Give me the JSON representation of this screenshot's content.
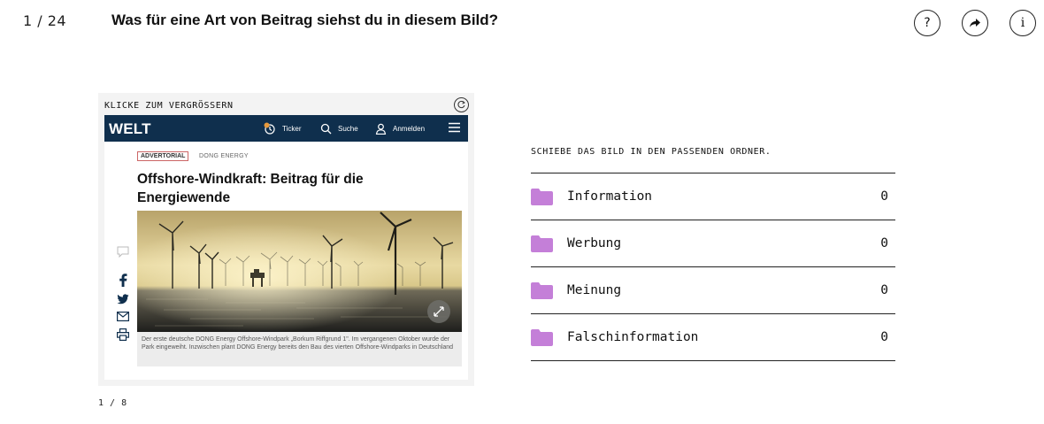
{
  "header": {
    "counter": "1 / 24",
    "question": "Was für eine Art von Beitrag siehst du in diesem Bild?",
    "buttons": {
      "help": "?",
      "share": "share-icon",
      "info": "i"
    }
  },
  "card": {
    "label": "KLICKE ZUM VERGRÖSSERN",
    "pager": "1 / 8",
    "article": {
      "brand": "WELT",
      "nav": {
        "ticker": "Ticker",
        "search": "Suche",
        "login": "Anmelden"
      },
      "tag": "ADVERTORIAL",
      "sponsor": "DONG ENERGY",
      "headline": "Offshore-Windkraft: Beitrag für die Energiewende",
      "caption": "Der erste deutsche DONG Energy Offshore-Windpark „Borkum Riffgrund 1\". Im vergangenen Oktober wurde der Park eingeweiht. Inzwischen plant DONG Energy bereits den Bau des vierten Offshore-Windparks in Deutschland",
      "colors": {
        "navbar": "#0f2f4d",
        "tag_border": "#cc6666"
      }
    }
  },
  "sort": {
    "instruction": "SCHIEBE DAS BILD IN DEN PASSENDEN ORDNER.",
    "folder_color": "#c47fd8",
    "folders": [
      {
        "name": "Information",
        "count": "0"
      },
      {
        "name": "Werbung",
        "count": "0"
      },
      {
        "name": "Meinung",
        "count": "0"
      },
      {
        "name": "Falschinformation",
        "count": "0"
      }
    ]
  }
}
